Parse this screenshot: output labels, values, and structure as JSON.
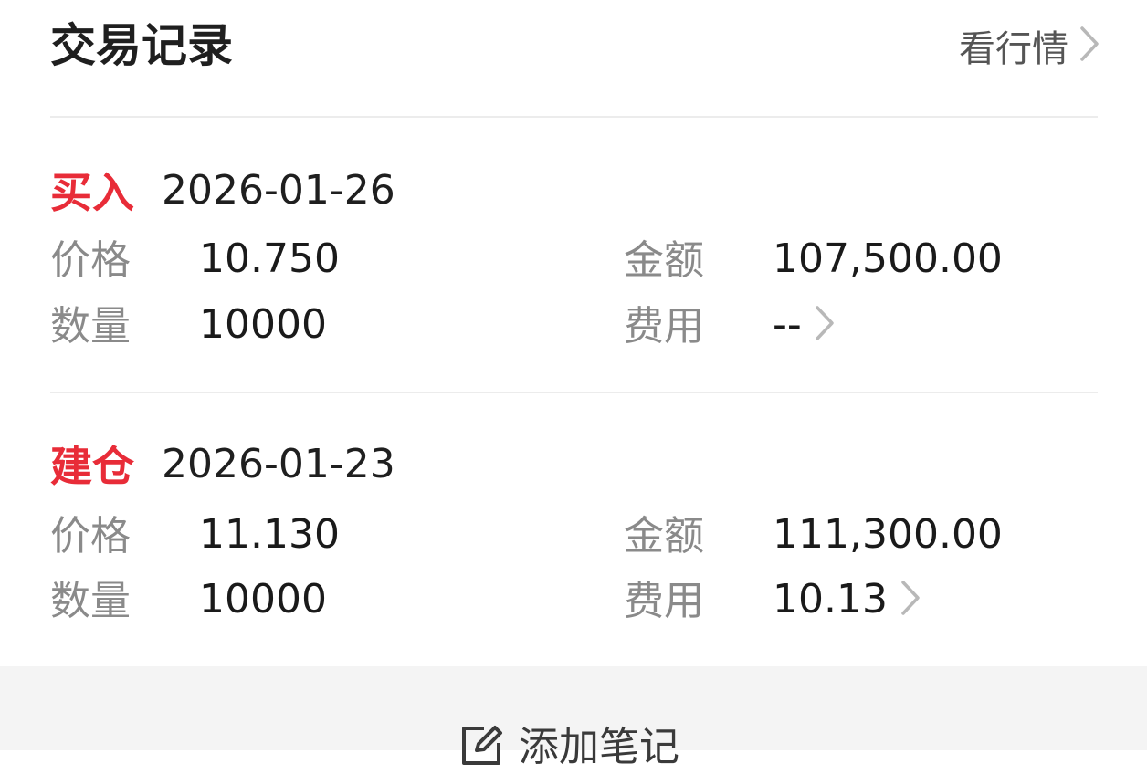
{
  "header": {
    "title": "交易记录",
    "market_link": "看行情"
  },
  "records": [
    {
      "type": "买入",
      "date": "2026-01-26",
      "price_label": "价格",
      "price": "10.750",
      "amount_label": "金额",
      "amount": "107,500.00",
      "qty_label": "数量",
      "qty": "10000",
      "fee_label": "费用",
      "fee": "--"
    },
    {
      "type": "建仓",
      "date": "2026-01-23",
      "price_label": "价格",
      "price": "11.130",
      "amount_label": "金额",
      "amount": "111,300.00",
      "qty_label": "数量",
      "qty": "10000",
      "fee_label": "费用",
      "fee": "10.13"
    }
  ],
  "footer": {
    "add_note_label": "添加笔记"
  },
  "colors": {
    "accent_red": "#e82c38",
    "label_gray": "#8a8a8a",
    "footer_bg": "#f4f4f4"
  },
  "icons": {
    "market_arrow": "chevron-right-icon",
    "fee_arrow": "chevron-right-icon",
    "add_note": "edit-note-icon"
  }
}
